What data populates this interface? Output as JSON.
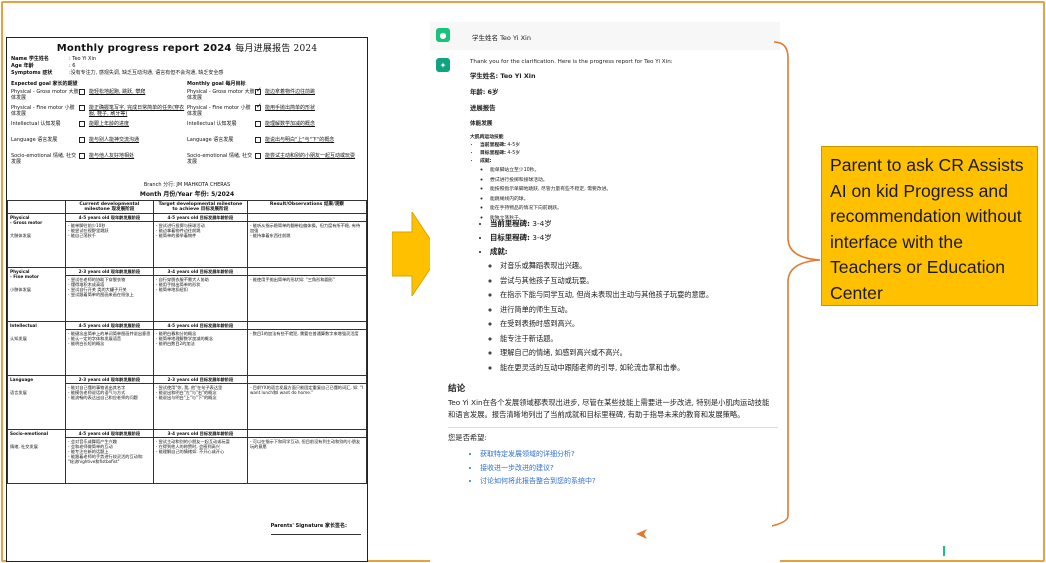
{
  "report": {
    "title_en": "Monthly progress report 2024",
    "title_zh": "每月进展报告 2024",
    "name_label": "Name 学生姓名",
    "name_value": ": Teo Yi Xin",
    "age_label": "Age 年龄",
    "age_value": ": 6",
    "symptoms_label": "Symptoms 症状",
    "symptoms_value": ":没有专注力, 感观失调, 缺乏互动沟通, 语言有但不会沟通, 缺乏安全感",
    "expected_goal_head": "Expected goal 家长的期望",
    "monthly_goal_head": "Monthly goal 每月目标",
    "expected_goals": [
      {
        "cat": "Physical - Gross motor 大肢体发展",
        "txt": "能轻松地起跑, 跳跃, 攀爬",
        "checked": false
      },
      {
        "cat": "Physical - Fine motor 小肢体发展",
        "txt": "能正确握笔写字, 完成日常简单的任务(穿衣服, 鞋子, 刷牙等)",
        "checked": false
      },
      {
        "cat": "Intellectual 认知发展",
        "txt": "能跟上年龄的进度",
        "checked": false
      },
      {
        "cat": "Language 语言发展",
        "txt": "能与别人能神交流沟通",
        "checked": false
      },
      {
        "cat": "Socio-emotional 情绪, 社交发展",
        "txt": "能与他人友好地相处",
        "checked": false
      }
    ],
    "monthly_goals": [
      {
        "cat": "Physical - Gross motor 大肢体发展",
        "txt": "能边拿着物件边往前跳",
        "checked": true
      },
      {
        "cat": "Physical - Fine motor 小肢体发展",
        "txt": "能用手抛出简单的形状",
        "checked": true
      },
      {
        "cat": "Intellectual 认知发展",
        "txt": "能理解数学加减的概念",
        "checked": false
      },
      {
        "cat": "Language 语言发展",
        "txt": "能说出与明白\"上\"与\"下\"的概念",
        "checked": false
      },
      {
        "cat": "Socio-emotional 情绪, 社交发展",
        "txt": "能尝试主动和别的小朋友一起互动或玩耍",
        "checked": false
      }
    ],
    "branch": "Branch 分行: JM MAHKOTA CHERAS",
    "month": "Month 月份/Year 年份: 5/2024",
    "col_current": "Current developmental milestone 现发展阶段",
    "col_target": "Target developmental milestone to achieve 目标发展阶段",
    "col_result": "Result/Observations 结果/观察",
    "sections": [
      {
        "name": "Physical",
        "sub": "- Gross motor",
        "zh": "大肢体发展",
        "age_cur": "4-5 years old 现年龄发展阶段",
        "age_tgt": "4-5 years old 目标发展年龄阶段",
        "cur": "- 能单脚往前少10秒\n- 能尝试在视野里跳跃\n- 能自己荡秋千",
        "tgt": "- 尝试进行投掷与接球活动\n- 能边拿着物件边往前跳\n- 能简单的操举着物件",
        "res": "- 能听从指示稳简单的翻带粒偏体操。但力度有所不稳, 有待加强\n- 能持拿着东西往前跳"
      },
      {
        "name": "Physical",
        "sub": "- Fine motor",
        "zh": "小肢体发展",
        "age_cur": "2-3 years old 现年龄发展阶段",
        "age_tgt": "3-4 years old 目标发展年龄阶段",
        "cur": "- 尝试在老师的协助下穿脱衣物\n- 懂得堆积木成高塔\n- 尝试自行开关 类的大罐子开关\n- 尝试跟着简单的图画来画在纸张上",
        "tgt": "- 自行穿脱衣服不需大人协助\n- 能用手抛出简单的形状\n- 能简单地扣纽扣",
        "res": "- 能使用手抛出简单的形状如: \"三角形和圆形\""
      },
      {
        "name": "Intellectual",
        "sub": "",
        "zh": "认知发展",
        "age_cur": "4-5 years old 现年龄发展阶段",
        "age_tgt": "4-5 years old 目标发展年龄阶段",
        "cur": "- 能键念出简单上的单词简单图画并说出意思\n- 能认一定的字体和发展语音\n- 能明白长短的概念",
        "tgt": "- 能明白春和分的概念\n- 能简单地理解数学加减的概念\n- 能明白数目2的加法",
        "res": "- 数目1的加法有些不就犯, 需要在普通算数字来增强灵活度"
      },
      {
        "name": "Language",
        "sub": "",
        "zh": "语言发展",
        "age_cur": "2-3 years old 现年龄发展阶段",
        "age_tgt": "2-3 years old 目标发展年龄阶段",
        "cur": "- 能对自己懂的事物说出其名字\n- 能模仿老师说话的语气与方式\n- 能流畅的表达出自己和应老师的问题",
        "tgt": "- 尝试使用\"你, 我, 他\"在句子表达里\n- 能说出和明白\"左\"与\"右\"的概念\n- 能说出与明白\"上\"与\"下\"的概念",
        "res": "- 目前YX的语言发展方面只能固定重复自己已懂的词汇, 如: \"I want lunch和I want do home.\""
      },
      {
        "name": "Socio-emotional",
        "sub": "",
        "zh": "情绪, 社交发展",
        "age_cur": "4-5 years old 现年龄发展阶段",
        "age_tgt": "3-4 years old 目标发展年龄阶段",
        "cur": "- 会对音乐或舞蹈产生兴趣\n- 会和老师做简单的互动\n- 能专注在新的话题上\n- 能跟着老师的手势进行较灵活的互动和: \"轮流hightive和fistbofist\"",
        "tgt": "- 尝试主动和别的小朋友一起互动或玩耍\n- 在得到他人的称赞时, 会感到高兴\n- 能理解自己的情绪如: 不开心或开心",
        "res": "- 可以在指示下和同学互动, 但目前没有到主动和别的小朋友玩的意愿"
      }
    ],
    "signature": "Parents' Signature 家长签名:"
  },
  "chat": {
    "user_message": "学生姓名 Teo Yi Xin",
    "bot_intro": "Thank you for the clarification. Here is the progress report for Teo Yi Xin:",
    "student_line": "学生姓名: Teo Yi Xin",
    "age_line": "年龄: 6岁",
    "progress_head": "进展报告",
    "physical_head": "体能发展",
    "gross_head": "大肌肉运动技能",
    "small_items": [
      {
        "label": "当前里程碑:",
        "value": " 4-5岁"
      },
      {
        "label": "目标里程碑:",
        "value": " 4-5岁"
      },
      {
        "label": "成就:",
        "value": ""
      }
    ],
    "small_achievements": [
      "能单脚站立至少10秒。",
      "尝试进行投掷和接球活动。",
      "能按照指示单脚地跳跃, 尽管力量有些不稳定, 需要改进。",
      "能跳绳线内的球。",
      "能在手持物品的情况下向前跳跃。",
      "能独立荡秋千。"
    ],
    "big_items": [
      {
        "label": "当前里程碑:",
        "value": " 3-4岁"
      },
      {
        "label": "目标里程碑:",
        "value": " 3-4岁"
      },
      {
        "label": "成就:",
        "value": ""
      }
    ],
    "big_achievements": [
      "对音乐或舞蹈表现出兴趣。",
      "尝试与其他孩子互动或玩耍。",
      "在指示下能与同学互动, 但尚未表现出主动与其他孩子玩耍的意愿。",
      "进行简单的师生互动。",
      "在受到表扬时感到高兴。",
      "能专注于新话题。",
      "理解自己的情绪, 如感到高兴或不高兴。",
      "能在更灵活的互动中跟随老师的引导, 如轮流击掌和击拳。"
    ],
    "conclusion_head": "结论",
    "conclusion_text": "Teo Yi Xin在各个发展领域都表现出进步, 尽管在某些技能上需要进一步改进, 特别是小肌肉运动技能和语言发展。报告清晰地列出了当前成就和目标里程碑, 有助于指导未来的教育和发展策略。",
    "ask_text": "您是否希望:",
    "links": [
      "获取特定发展领域的详细分析?",
      "接收进一步改进的建议?",
      "讨论如何将此报告整合到您的系统中?"
    ]
  },
  "callout": {
    "text": "Parent to ask CR Assists AI on kid Progress and recommendation without interface with the Teachers or Education Center"
  },
  "colors": {
    "frame": "#e8a040",
    "arrow": "#ffc000",
    "callout_bg": "#ffc000",
    "bracket": "#e07a30",
    "link": "#2f6fd0"
  }
}
